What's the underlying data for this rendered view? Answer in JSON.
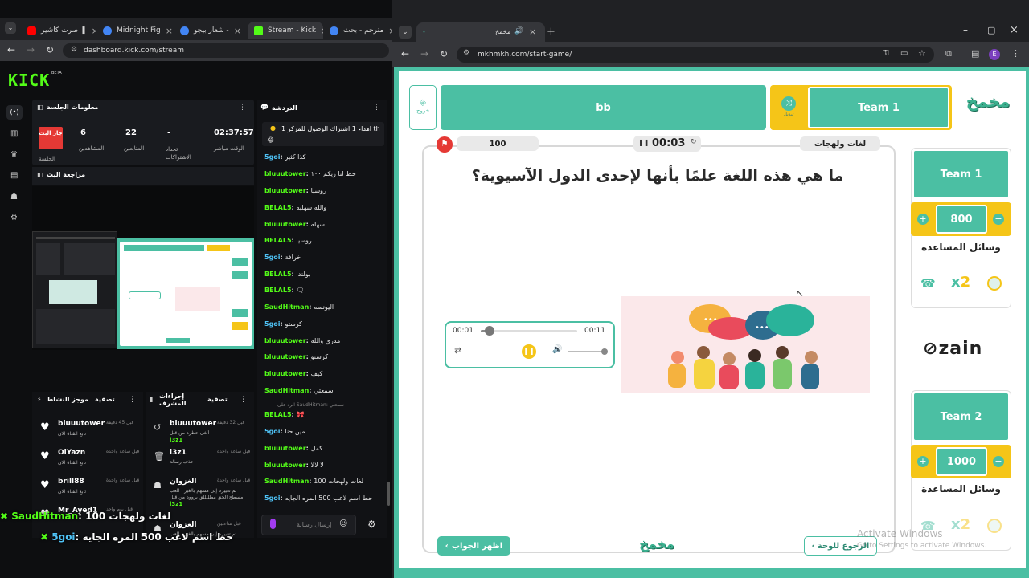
{
  "left_browser": {
    "tabs": [
      {
        "label": "صرت كاشير ❚",
        "color": "#ff0000"
      },
      {
        "label": "Midnight Fig",
        "color": "#4285f4"
      },
      {
        "label": "شعار بيجو -",
        "color": "#4285f4"
      },
      {
        "label": "Stream - Kick",
        "color": "#53fc18"
      },
      {
        "label": "مترجم - بحث",
        "color": "#4285f4"
      }
    ],
    "url": "dashboard.kick.com/stream"
  },
  "kick": {
    "logo": "KICK",
    "beta": "BETA",
    "session_info_title": "معلومات الجلسة",
    "live_badge": "جار البث",
    "stats": [
      {
        "value": "6",
        "label": "المشاهدين"
      },
      {
        "value": "22",
        "label": "المتابعين"
      },
      {
        "value": "-",
        "label": "تحداد الاشتراكات"
      },
      {
        "value": "02:37:57",
        "label": "الوقت مباشر"
      }
    ],
    "session_label": "الجلسة",
    "stream_review": "مراجعة البث",
    "chat_title": "الدردشة",
    "pinned": "اهداء 1 اشتراك الوصول للمركز 1 th",
    "chat": [
      {
        "user": "5goi",
        "msg": "كذا كثير",
        "blue": true
      },
      {
        "user": "bluuutower",
        "msg": "حط لنا زيكم ١٠٠"
      },
      {
        "user": "bluuutower",
        "msg": "روسيا"
      },
      {
        "user": "BELAL5",
        "msg": "والله سهليه"
      },
      {
        "user": "bluuutower",
        "msg": "سهله"
      },
      {
        "user": "BELAL5",
        "msg": "روسيا"
      },
      {
        "user": "5goi",
        "msg": "خرافة",
        "blue": true
      },
      {
        "user": "BELAL5",
        "msg": "بولندا"
      },
      {
        "user": "BELAL5",
        "msg": "🗨"
      },
      {
        "user": "SaudHitman",
        "msg": "اليونسه"
      },
      {
        "user": "5goi",
        "msg": "كرستو",
        "blue": true
      },
      {
        "user": "bluuutower",
        "msg": "مدري والله"
      },
      {
        "user": "bluuutower",
        "msg": "كرستو"
      },
      {
        "user": "bluuutower",
        "msg": "كيف"
      },
      {
        "user": "SaudHitman",
        "msg": "سمعتي"
      },
      {
        "user": "BELAL5",
        "msg": "🎀"
      },
      {
        "user": "5goi",
        "msg": "مين حنا",
        "blue": true
      },
      {
        "user": "bluuutower",
        "msg": "كمل"
      },
      {
        "user": "bluuutower",
        "msg": "لا لالا"
      },
      {
        "user": "SaudHitman",
        "msg": "لغات ولهجات 100"
      },
      {
        "user": "5goi",
        "msg": "حط اسم لاعب 500 المره الجايه",
        "blue": true
      }
    ],
    "reply_note": "الرد على SaudHitman: سمعتي",
    "chat_placeholder": "إرسال رسالة",
    "activity_title": "موجز النشاط",
    "filter_label": "تصفية",
    "activity": [
      {
        "user": "bluuutower",
        "action": "تابع القناة الان",
        "time": "قبل 45 دقيقة"
      },
      {
        "user": "OiYazn",
        "action": "تابع القناة الان",
        "time": "قبل ساعة واحدة"
      },
      {
        "user": "brill88",
        "action": "تابع القناة الان",
        "time": "قبل ساعة واحدة"
      },
      {
        "user": "Mr_Ayed1",
        "action": "",
        "time": "قبل يوم واحد"
      }
    ],
    "mod_title": "إجراءات المشرف",
    "mod": [
      {
        "user": "bluuutower",
        "action": "ألغى حظره من قبل",
        "by": "l3z1",
        "time": "قبل 32 دقيقة"
      },
      {
        "user": "l3z1",
        "action": "حذف رسالة",
        "by": "",
        "time": "قبل ساعة واحدة"
      },
      {
        "user": "الغزوان",
        "action": "تم تغييره إلى مسهم بالغير | العب مسطح الحق مطللللق برووه من قبل",
        "by": "l3z1",
        "time": "قبل ساعة واحدة"
      },
      {
        "user": "الغزوان",
        "action": "تم تغييره إلى مسهم بالغير | العب",
        "by": "",
        "time": "قبل ساعتين"
      }
    ]
  },
  "overlay": {
    "line1_user": "SaudHitman",
    "line1_msg": "لغات ولهجات 100",
    "line2_user": "5goi",
    "line2_msg": "حط اسم لاعب 500 المره الجايه"
  },
  "right_browser": {
    "tab_title": "مخمخ",
    "url": "mkhmkh.com/start-game/"
  },
  "game": {
    "exit_label": "خروج",
    "team_b": "bb",
    "team_a": "Team 1",
    "swap_label": "تبديل",
    "logo": "مخمخ",
    "points_pill": "100",
    "timer": "00:03",
    "category_pill": "لغات ولهجات",
    "question": "ما هي هذه اللغة علمًا بأنها لإحدى الدول الآسيوية؟",
    "audio_current": "00:01",
    "audio_total": "00:11",
    "audio_progress": 0.09,
    "show_answer": "اظهر الجواب",
    "back_to_board": "الرجوع للوحة",
    "team1_name": "Team 1",
    "team1_score": "800",
    "team2_name": "Team 2",
    "team2_score": "1000",
    "helpers_title": "وسائل المساعدة",
    "sponsor": "zain",
    "watermark_title": "Activate Windows",
    "watermark_sub": "Go to Settings to activate Windows."
  },
  "colors": {
    "kick_green": "#53fc18",
    "game_teal": "#4bbfa3",
    "game_yellow": "#f5c518",
    "flag_red": "#e53935"
  }
}
